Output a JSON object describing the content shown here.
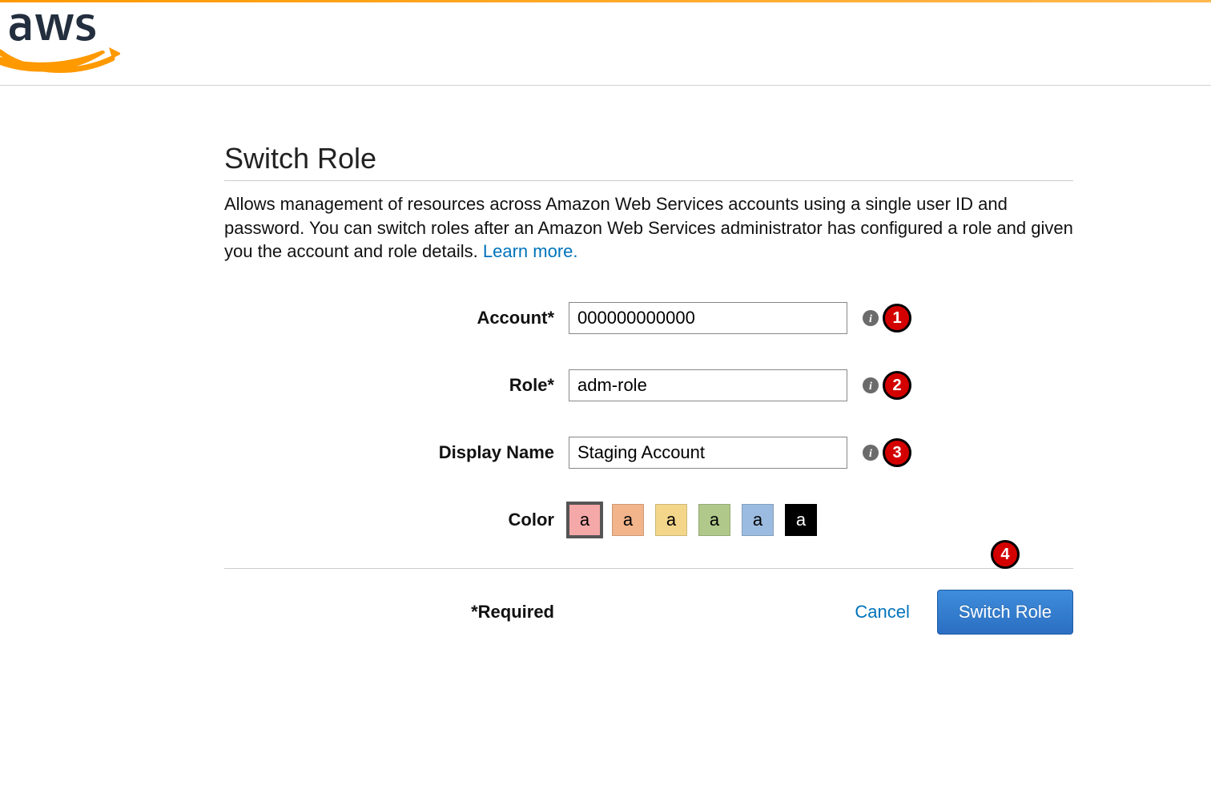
{
  "header": {
    "logo_alt": "AWS"
  },
  "page": {
    "title": "Switch Role",
    "description": "Allows management of resources across Amazon Web Services accounts using a single user ID and password. You can switch roles after an Amazon Web Services administrator has configured a role and given you the account and role details. ",
    "learn_more": "Learn more."
  },
  "form": {
    "account": {
      "label": "Account*",
      "value": "000000000000"
    },
    "role": {
      "label": "Role*",
      "value": "adm-role"
    },
    "display": {
      "label": "Display Name",
      "value": "Staging Account"
    },
    "color": {
      "label": "Color",
      "swatch_letter": "a",
      "options": [
        {
          "name": "pink",
          "selected": true
        },
        {
          "name": "orange",
          "selected": false
        },
        {
          "name": "yellow",
          "selected": false
        },
        {
          "name": "green",
          "selected": false
        },
        {
          "name": "blue",
          "selected": false
        },
        {
          "name": "black",
          "selected": false
        }
      ]
    }
  },
  "footer": {
    "required_note": "*Required",
    "cancel": "Cancel",
    "submit": "Switch Role"
  },
  "annotations": {
    "a1": "1",
    "a2": "2",
    "a3": "3",
    "a4": "4"
  }
}
